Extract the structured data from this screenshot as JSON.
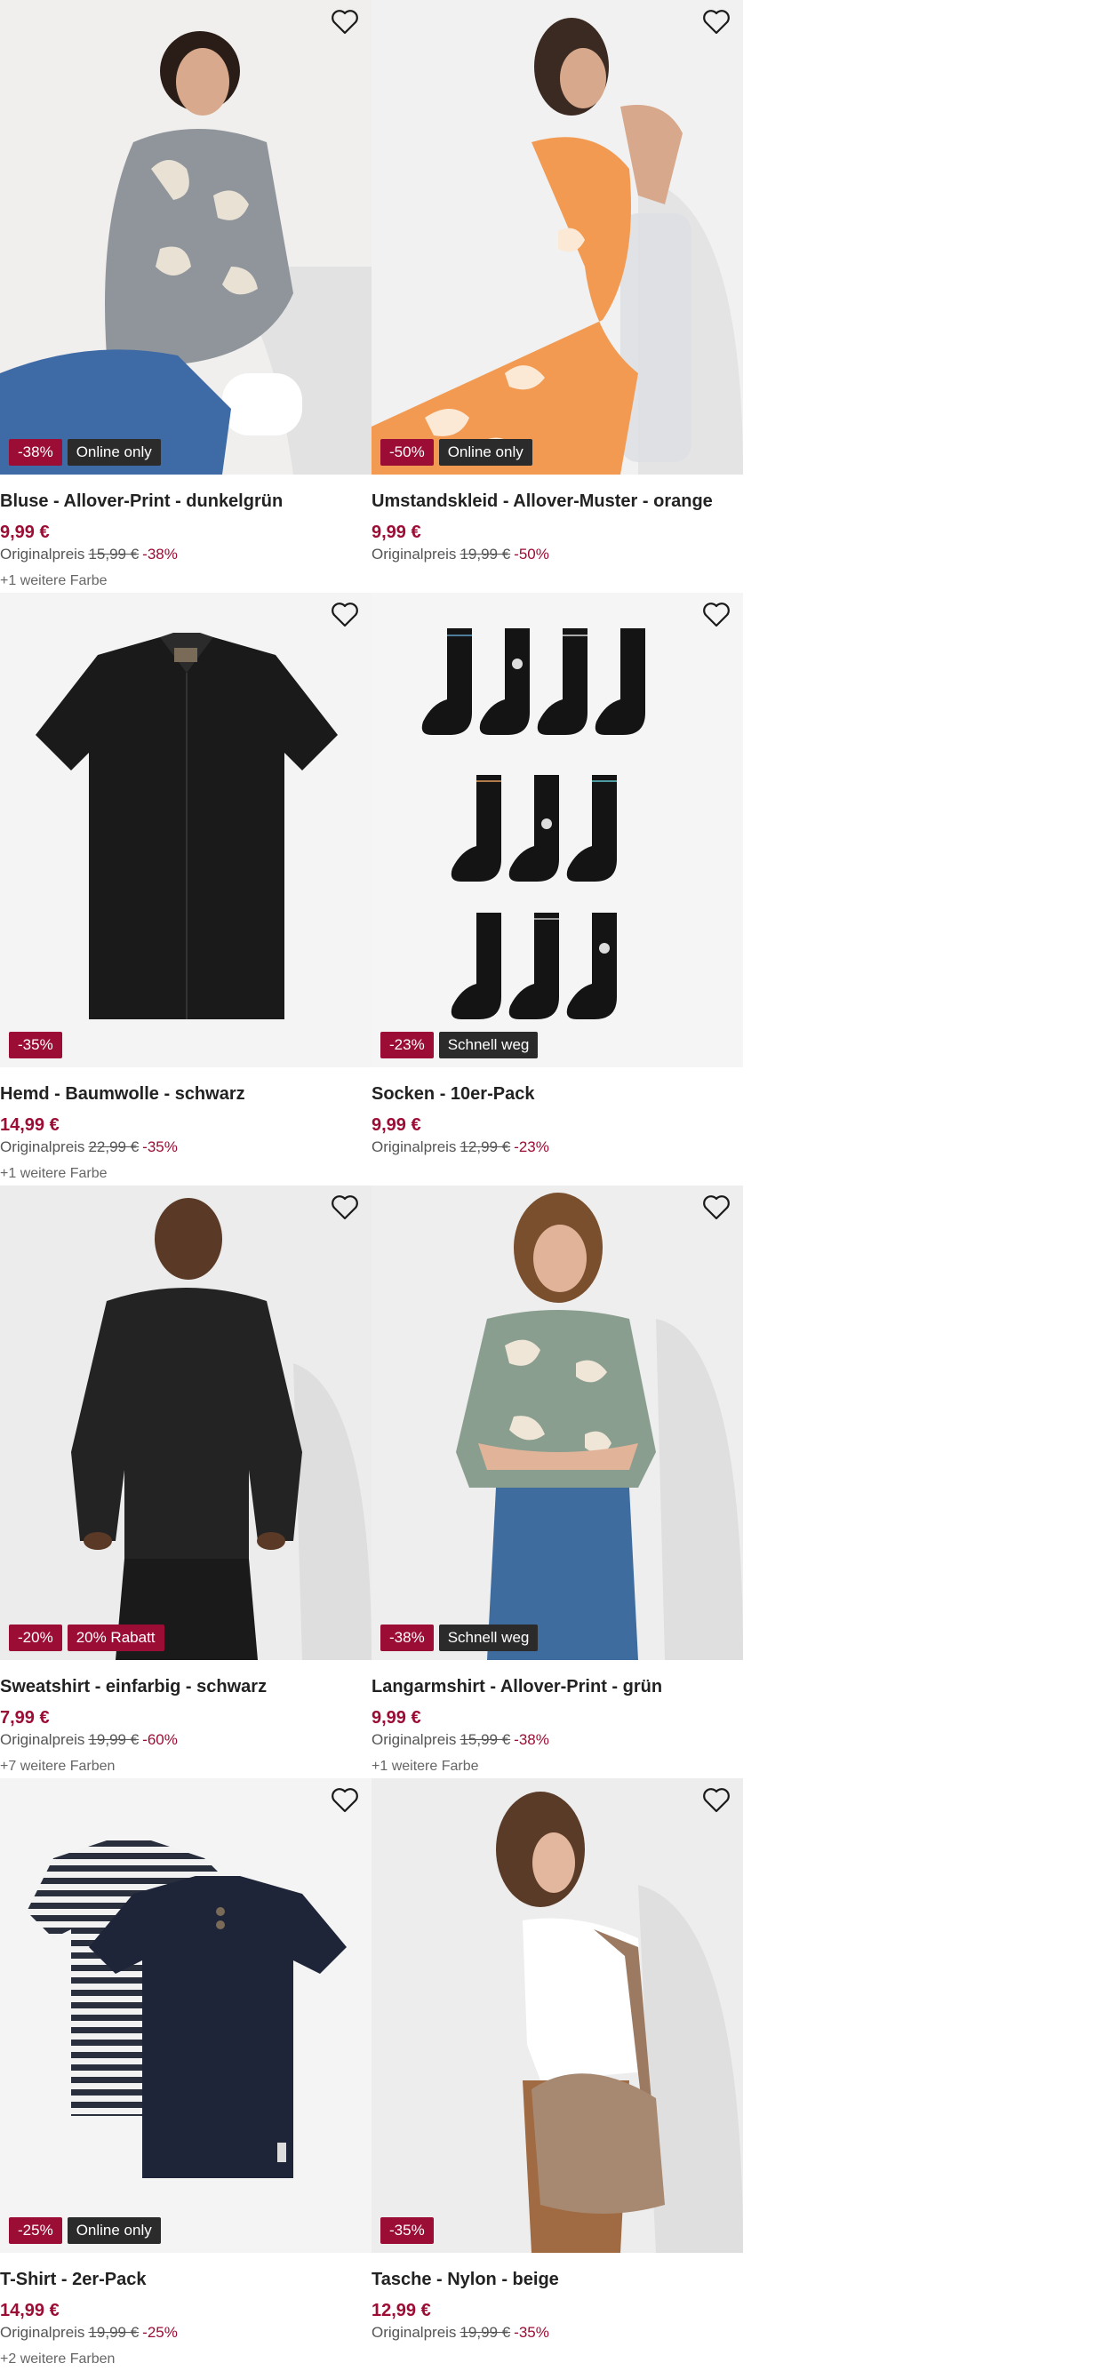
{
  "products": [
    {
      "name": "Bluse - Allover-Print - dunkelgrün",
      "price": "9,99 €",
      "original_label": "Originalpreis",
      "original_price": "15,99 €",
      "discount": "-38%",
      "more_colors": "+1 weitere Farbe",
      "badges": [
        {
          "text": "-38%",
          "style": "red"
        },
        {
          "text": "Online only",
          "style": "dark"
        }
      ],
      "image": "woman-print-blouse"
    },
    {
      "name": "Umstandskleid - Allover-Muster - orange",
      "price": "9,99 €",
      "original_label": "Originalpreis",
      "original_price": "19,99 €",
      "discount": "-50%",
      "more_colors": "",
      "badges": [
        {
          "text": "-50%",
          "style": "red"
        },
        {
          "text": "Online only",
          "style": "dark"
        }
      ],
      "image": "woman-orange-dress"
    },
    {
      "name": "Hemd - Baumwolle - schwarz",
      "price": "14,99 €",
      "original_label": "Originalpreis",
      "original_price": "22,99 €",
      "discount": "-35%",
      "more_colors": "+1 weitere Farbe",
      "badges": [
        {
          "text": "-35%",
          "style": "red"
        }
      ],
      "image": "black-shirt"
    },
    {
      "name": "Socken - 10er-Pack",
      "price": "9,99 €",
      "original_label": "Originalpreis",
      "original_price": "12,99 €",
      "discount": "-23%",
      "more_colors": "",
      "badges": [
        {
          "text": "-23%",
          "style": "red"
        },
        {
          "text": "Schnell weg",
          "style": "dark"
        }
      ],
      "image": "socks-pack"
    },
    {
      "name": "Sweatshirt - einfarbig - schwarz",
      "price": "7,99 €",
      "original_label": "Originalpreis",
      "original_price": "19,99 €",
      "discount": "-60%",
      "more_colors": "+7 weitere Farben",
      "badges": [
        {
          "text": "-20%",
          "style": "red"
        },
        {
          "text": "20% Rabatt",
          "style": "red"
        }
      ],
      "image": "man-black-sweatshirt"
    },
    {
      "name": "Langarmshirt - Allover-Print - grün",
      "price": "9,99 €",
      "original_label": "Originalpreis",
      "original_price": "15,99 €",
      "discount": "-38%",
      "more_colors": "+1 weitere Farbe",
      "badges": [
        {
          "text": "-38%",
          "style": "red"
        },
        {
          "text": "Schnell weg",
          "style": "dark"
        }
      ],
      "image": "woman-green-longsleeve"
    },
    {
      "name": "T-Shirt - 2er-Pack",
      "price": "14,99 €",
      "original_label": "Originalpreis",
      "original_price": "19,99 €",
      "discount": "-25%",
      "more_colors": "+2 weitere Farben",
      "badges": [
        {
          "text": "-25%",
          "style": "red"
        },
        {
          "text": "Online only",
          "style": "dark"
        }
      ],
      "image": "tshirt-2-pack"
    },
    {
      "name": "Tasche - Nylon - beige",
      "price": "12,99 €",
      "original_label": "Originalpreis",
      "original_price": "19,99 €",
      "discount": "-35%",
      "more_colors": "",
      "badges": [
        {
          "text": "-35%",
          "style": "red"
        }
      ],
      "image": "woman-beige-bag"
    }
  ],
  "colors": {
    "sale_red": "#9b0d34",
    "badge_dark": "#2b2b2b",
    "image_bg": "#f2f2f2"
  },
  "icons": {
    "favorite": "heart-outline-icon"
  }
}
